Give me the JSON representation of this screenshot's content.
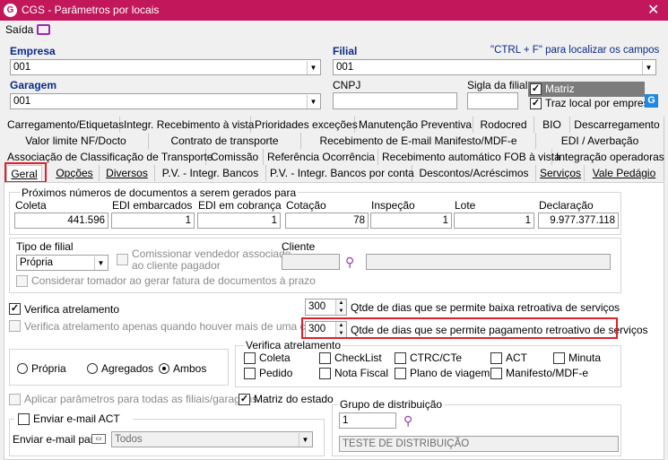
{
  "window": {
    "title": "CGS - Parâmetros por locais"
  },
  "menu": {
    "saida": "Saída"
  },
  "header": {
    "empresa_label": "Empresa",
    "empresa_value": "001",
    "filial_label": "Filial",
    "filial_value": "001",
    "hint": "\"CTRL + F\" para localizar os campos",
    "garagem_label": "Garagem",
    "garagem_value": "001",
    "cnpj_label": "CNPJ",
    "cnpj_value": "",
    "sigla_label": "Sigla da filial",
    "sigla_value": "",
    "matriz_label": "Matriz",
    "traz_local_label": "Traz local por empresa"
  },
  "tabs_row1": [
    "Carregamento/Etiquetas",
    "Integr. Recebimento à vista",
    "Prioridades exceções",
    "Manutenção Preventiva",
    "Rodocred",
    "BIO",
    "Descarregamento"
  ],
  "tabs_row2": [
    "Valor limite NF/Docto",
    "Contrato de transporte",
    "Recebimento de E-mail Manifesto/MDF-e",
    "EDI / Averbação"
  ],
  "tabs_row3": [
    "Associação de Classificação de Transporte",
    "Comissão",
    "Referência Ocorrência",
    "Recebimento automático FOB à vista",
    "Integração operadoras"
  ],
  "tabs_row4": [
    "Geral",
    "Opções",
    "Diversos",
    "P.V. - Integr. Bancos",
    "P.V. - Integr. Bancos por conta",
    "Descontos/Acréscimos",
    "Serviços",
    "Vale Pedágio"
  ],
  "proximos": {
    "title": "Próximos números de documentos a serem gerados para",
    "fields": [
      {
        "label": "Coleta",
        "value": "441.596"
      },
      {
        "label": "EDI embarcados",
        "value": "1"
      },
      {
        "label": "EDI em cobrança",
        "value": "1"
      },
      {
        "label": "Cotação",
        "value": "78"
      },
      {
        "label": "Inspeção",
        "value": "1"
      },
      {
        "label": "Lote",
        "value": "1"
      },
      {
        "label": "Declaração",
        "value": "9.977.377.118"
      }
    ]
  },
  "tipo_filial": {
    "label": "Tipo de filial",
    "value": "Própria",
    "comissionar_label_1": "Comissionar vendedor associado",
    "comissionar_label_2": "ao cliente pagador",
    "cliente_label": "Cliente",
    "considerar_label": "Considerar tomador ao gerar fatura de documentos à prazo"
  },
  "atrelamento": {
    "verifica_label": "Verifica atrelamento",
    "verifica_apenas_label": "Verifica atrelamento apenas quando houver mais de uma carreta",
    "baixa_value": "300",
    "baixa_label": "Qtde de dias que se permite baixa retroativa de serviços",
    "pagamento_value": "300",
    "pagamento_label": "Qtde de dias que se permite pagamento retroativo de serviços"
  },
  "radios": {
    "propria": "Própria",
    "agregados": "Agregados",
    "ambos": "Ambos"
  },
  "verifica_group": {
    "title": "Verifica atrelamento",
    "items": [
      "Coleta",
      "CheckList",
      "CTRC/CTe",
      "ACT",
      "Minuta",
      "Pedido",
      "Nota Fiscal",
      "Plano de viagem",
      "Manifesto/MDF-e"
    ]
  },
  "bottom": {
    "aplicar_label": "Aplicar parâmetros para todas as filiais/garagens",
    "matriz_estado_label": "Matriz do estado",
    "enviar_email_label": "Enviar e-mail ACT",
    "enviar_para_label": "Enviar e-mail para",
    "enviar_para_value": "Todos",
    "grupo_label": "Grupo de distribuição",
    "grupo_value": "1",
    "grupo_desc": "TESTE DE DISTRIBUIÇÃO"
  }
}
